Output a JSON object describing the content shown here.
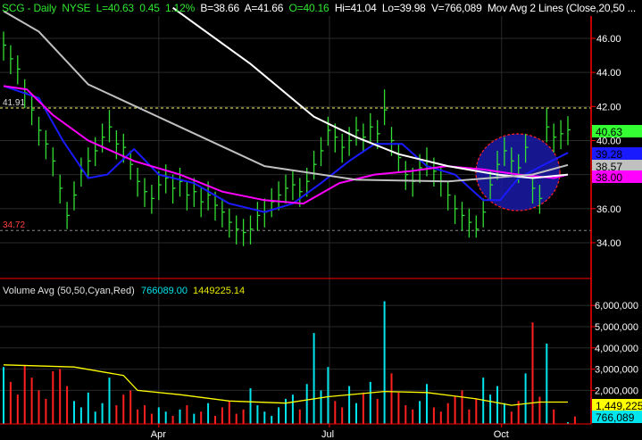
{
  "header": {
    "symbol": "SCG - Daily",
    "exchange": "NYSE",
    "last": "L=40.63",
    "change": "0.45",
    "change_pct": "1.12%",
    "bid": "B=38.66",
    "ask": "A=41.66",
    "open": "O=40.16",
    "high": "Hi=41.04",
    "low": "Lo=39.98",
    "volume": "V=766,089",
    "study": "Mov Avg 2 Lines (Close,20,50 ..."
  },
  "colors": {
    "up": "#33ff33",
    "price_bar": "#33dd33",
    "ma20": "#1a1aff",
    "ma50": "#ff00ff",
    "ma100": "#ffffff",
    "ma200": "#c0c0c0",
    "vol_up": "#00e5ee",
    "vol_down": "#ff2020",
    "vol_avg": "#ffff00",
    "axis": "#ff0000"
  },
  "chart_data": [
    {
      "type": "ohlc",
      "title": "SCG - Daily",
      "ylim": [
        33.2,
        47.5
      ],
      "y_ticks": [
        "46.00",
        "44.00",
        "42.00",
        "40.00",
        "38.00",
        "36.00",
        "34.00"
      ],
      "y_tick_values": [
        46,
        44,
        42,
        40,
        38,
        36,
        34
      ],
      "x_ticks": [
        {
          "label": "Apr",
          "index": 22
        },
        {
          "label": "Jul",
          "index": 46.2
        },
        {
          "label": "Oct",
          "index": 70.6
        }
      ],
      "bar_range": 0.8,
      "closes": [
        45.6,
        44.8,
        44.2,
        42.8,
        41.8,
        40.6,
        39.8,
        38.8,
        37.2,
        35.6,
        36.8,
        38.2,
        38.8,
        39.4,
        40.2,
        40.8,
        39.8,
        39.6,
        38.6,
        37.6,
        37.0,
        36.6,
        37.4,
        37.8,
        37.2,
        37.6,
        36.8,
        37.0,
        36.4,
        36.8,
        36.2,
        35.8,
        35.2,
        34.8,
        34.6,
        34.8,
        35.6,
        35.8,
        36.4,
        36.8,
        37.2,
        37.4,
        37.0,
        37.6,
        38.6,
        39.4,
        40.6,
        40.2,
        39.6,
        40.0,
        40.6,
        40.2,
        40.8,
        40.4,
        41.8,
        40.0,
        39.0,
        38.0,
        37.6,
        38.4,
        38.8,
        38.2,
        37.6,
        36.8,
        36.0,
        35.6,
        35.2,
        34.8,
        35.8,
        37.4,
        38.6,
        39.4,
        38.8,
        38.4,
        39.6,
        37.2,
        36.6,
        40.8,
        40.2,
        40.4,
        40.63
      ],
      "extremes": [
        {
          "index": 15,
          "high": 41.8
        },
        {
          "index": 54,
          "high": 43.0
        },
        {
          "index": 9,
          "low": 34.8
        },
        {
          "index": 34,
          "low": 33.8
        },
        {
          "index": 77,
          "high": 41.9
        },
        {
          "index": 67,
          "low": 34.3
        }
      ],
      "reference_lines": [
        {
          "value": 41.91,
          "label": "41.91",
          "color": "#dddddd"
        },
        {
          "value": 34.72,
          "label": "34.72",
          "color": "#ff4040"
        }
      ],
      "series": [
        {
          "name": "MA20",
          "color": "#1a1aff",
          "points": [
            [
              0,
              43.2
            ],
            [
              5,
              42.5
            ],
            [
              8.4,
              40
            ],
            [
              12,
              37.8
            ],
            [
              14.7,
              38
            ],
            [
              18.5,
              39.5
            ],
            [
              22,
              38
            ],
            [
              27,
              37.5
            ],
            [
              32,
              36.3
            ],
            [
              37,
              35.8
            ],
            [
              41,
              36.3
            ],
            [
              45,
              37.5
            ],
            [
              49,
              38.8
            ],
            [
              52.6,
              39.8
            ],
            [
              56.5,
              39.8
            ],
            [
              60,
              38.5
            ],
            [
              64,
              38
            ],
            [
              68,
              36.5
            ],
            [
              70.4,
              36.5
            ],
            [
              73,
              37.8
            ],
            [
              76.7,
              38.6
            ],
            [
              80,
              39.28
            ]
          ]
        },
        {
          "name": "MA50",
          "color": "#ff00ff",
          "points": [
            [
              0,
              43.2
            ],
            [
              3.3,
              43
            ],
            [
              7,
              41.5
            ],
            [
              12,
              40
            ],
            [
              18.5,
              38.8
            ],
            [
              25,
              38
            ],
            [
              31,
              37
            ],
            [
              37,
              36.5
            ],
            [
              42.5,
              36.3
            ],
            [
              47.6,
              37.5
            ],
            [
              52.6,
              38
            ],
            [
              57.7,
              38.2
            ],
            [
              62.8,
              38.5
            ],
            [
              68,
              38.3
            ],
            [
              73,
              38
            ],
            [
              78,
              37.8
            ],
            [
              80,
              38.0
            ]
          ]
        },
        {
          "name": "MA100",
          "color": "#ffffff",
          "points": [
            [
              24,
              47.8
            ],
            [
              35,
              44.5
            ],
            [
              44,
              41.4
            ],
            [
              50,
              40.2
            ],
            [
              56,
              39.2
            ],
            [
              63,
              38.5
            ],
            [
              70,
              38.0
            ],
            [
              75,
              37.8
            ],
            [
              80,
              38.0
            ]
          ]
        },
        {
          "name": "MA200",
          "color": "#c0c0c0",
          "points": [
            [
              0,
              47.6
            ],
            [
              5,
              46.4
            ],
            [
              12,
              43.3
            ],
            [
              25,
              40.8
            ],
            [
              37,
              38.5
            ],
            [
              50,
              37.7
            ],
            [
              63,
              37.6
            ],
            [
              75,
              38.0
            ],
            [
              80,
              38.57
            ]
          ]
        }
      ],
      "last_labels": [
        {
          "label": "40.63",
          "value": 40.63,
          "bg": "#33ff33",
          "fg": "#000"
        },
        {
          "label": "39.28",
          "value": 39.28,
          "bg": "#1a1aff",
          "fg": "#000"
        },
        {
          "label": "38.57",
          "value": 38.57,
          "bg": "#c0c0c0",
          "fg": "#000"
        },
        {
          "label": "38.00",
          "value": 38.0,
          "bg": "#ff00ff",
          "fg": "#000"
        }
      ]
    },
    {
      "type": "bar",
      "title": "Volume Avg (50,50,Cyan,Red)",
      "value_current": "766089.00",
      "value_avg": "1449225.14",
      "unit": "millions",
      "y_ticks": [
        "6,000,000",
        "5,000,000",
        "4,000,000",
        "3,000,000",
        "2,000,000"
      ],
      "y_tick_values": [
        6,
        5,
        4,
        3,
        2
      ],
      "values": [
        3.1,
        2.4,
        1.8,
        3.2,
        2.6,
        2.0,
        1.6,
        2.9,
        3.0,
        2.2,
        1.5,
        1.2,
        1.9,
        1.0,
        1.4,
        2.6,
        1.3,
        1.8,
        2.0,
        1.1,
        1.3,
        0.9,
        1.2,
        1.0,
        0.8,
        1.1,
        1.3,
        0.9,
        1.0,
        1.4,
        0.8,
        1.2,
        1.5,
        0.9,
        1.1,
        2.1,
        1.3,
        1.0,
        0.8,
        1.2,
        1.6,
        1.8,
        1.1,
        2.3,
        4.7,
        2.0,
        3.1,
        1.5,
        1.2,
        2.2,
        1.4,
        1.9,
        2.4,
        1.6,
        6.2,
        2.8,
        1.9,
        1.3,
        1.1,
        1.5,
        2.3,
        1.2,
        1.0,
        1.4,
        1.7,
        2.0,
        1.1,
        1.6,
        2.6,
        1.8,
        2.2,
        1.4,
        1.0,
        1.5,
        2.8,
        5.2,
        1.7,
        4.2,
        1.1,
        0.4,
        0.5,
        0.77
      ],
      "avg_line": [
        [
          0,
          3.2
        ],
        [
          10,
          3.1
        ],
        [
          17,
          2.7
        ],
        [
          19,
          2.0
        ],
        [
          25,
          1.8
        ],
        [
          32,
          1.5
        ],
        [
          40,
          1.4
        ],
        [
          46,
          1.7
        ],
        [
          54,
          1.95
        ],
        [
          60,
          1.9
        ],
        [
          67,
          1.6
        ],
        [
          72,
          1.3
        ],
        [
          76,
          1.45
        ],
        [
          80,
          1.449
        ]
      ],
      "last_labels": [
        {
          "label": "1,449,225",
          "value": 1.449,
          "bg": "#ffff00",
          "fg": "#000"
        },
        {
          "label": "766,089",
          "value": 0.766,
          "bg": "#00e5ee",
          "fg": "#000"
        }
      ]
    }
  ]
}
